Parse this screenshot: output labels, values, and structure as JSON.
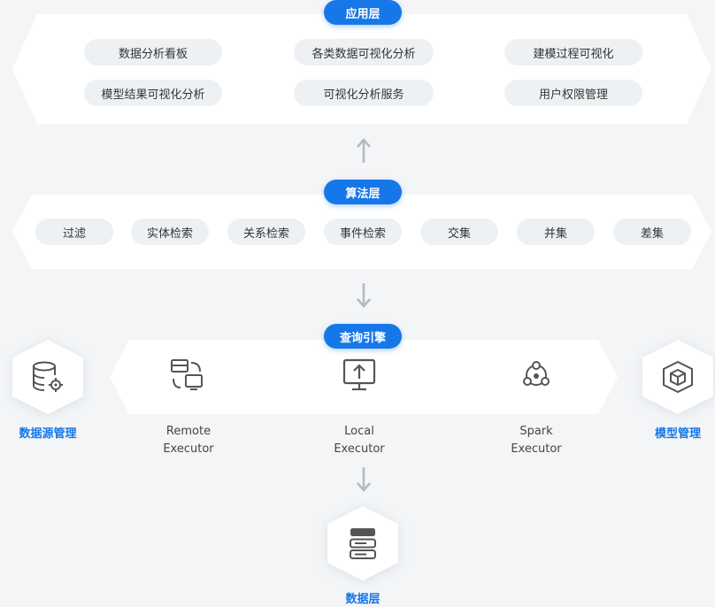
{
  "app_layer": {
    "title": "应用层",
    "items": [
      "数据分析看板",
      "各类数据可视化分析",
      "建模过程可视化",
      "模型结果可视化分析",
      "可视化分析服务",
      "用户权限管理"
    ]
  },
  "algorithm_layer": {
    "title": "算法层",
    "items": [
      "过滤",
      "实体检索",
      "关系检索",
      "事件检索",
      "交集",
      "并集",
      "差集"
    ]
  },
  "engine_layer": {
    "title": "查询引擎",
    "executors": [
      {
        "line1": "Remote",
        "line2": "Executor",
        "icon": "remote-executor-icon"
      },
      {
        "line1": "Local",
        "line2": "Executor",
        "icon": "local-executor-icon"
      },
      {
        "line1": "Spark",
        "line2": "Executor",
        "icon": "spark-executor-icon"
      }
    ]
  },
  "side_nodes": {
    "datasource": {
      "label": "数据源管理",
      "icon": "database-settings-icon"
    },
    "model": {
      "label": "模型管理",
      "icon": "cube-icon"
    }
  },
  "data_layer": {
    "label": "数据层",
    "icon": "server-stack-icon"
  },
  "colors": {
    "accent": "#1677e8",
    "pill_bg": "#eef1f4",
    "icon": "#555555",
    "arrow": "#b5b9bf"
  }
}
